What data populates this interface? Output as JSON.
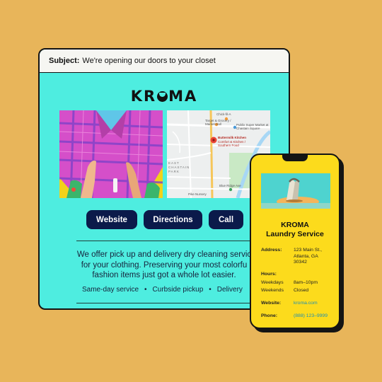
{
  "email": {
    "subject_label": "Subject:",
    "subject_text": "We're opening our doors to your closet",
    "brand": {
      "k": "KR",
      "rest": "MA"
    },
    "buttons": {
      "website": "Website",
      "directions": "Directions",
      "call": "Call"
    },
    "body_line1": "We offer pick up and delivery dry cleaning servic",
    "body_line2": "for your clothing. Preserving your most colorfu",
    "body_line3": "fashion items just got a whole lot easier.",
    "features": [
      "Same-day service",
      "Curbside pickup",
      "Delivery"
    ],
    "map_labels": {
      "a": "Chick-fil-A",
      "b": "Target & Grocery / Market Hall",
      "c": "Publix Super Market at Chastain Square",
      "d": "Buttermilk Kitchen",
      "e": "Comfort & Kitchen / Southern Food",
      "f": "EAST CHASTAIN PARK",
      "g": "Blue Ridge Ave",
      "h": "Pike Nursery"
    }
  },
  "card": {
    "title_line1": "KROMA",
    "title_line2": "Laundry Service",
    "address_label": "Address:",
    "address_lines": [
      "123 Main St.,",
      "Atlanta, GA",
      "30342"
    ],
    "hours_label": "Hours:",
    "weekdays_label": "Weekdays",
    "weekdays_value": "8am–10pm",
    "weekends_label": "Weekends",
    "weekends_value": "Closed",
    "website_label": "Website:",
    "website_value": "kroma.com",
    "phone_label": "Phone:",
    "phone_value": "(888) 123–9999"
  },
  "colors": {
    "page_bg": "#E8B55A",
    "email_bg": "#4EEDE0",
    "button_bg": "#0B1A4A",
    "card_bg": "#FCDB1C",
    "link": "#1C8FB4"
  }
}
